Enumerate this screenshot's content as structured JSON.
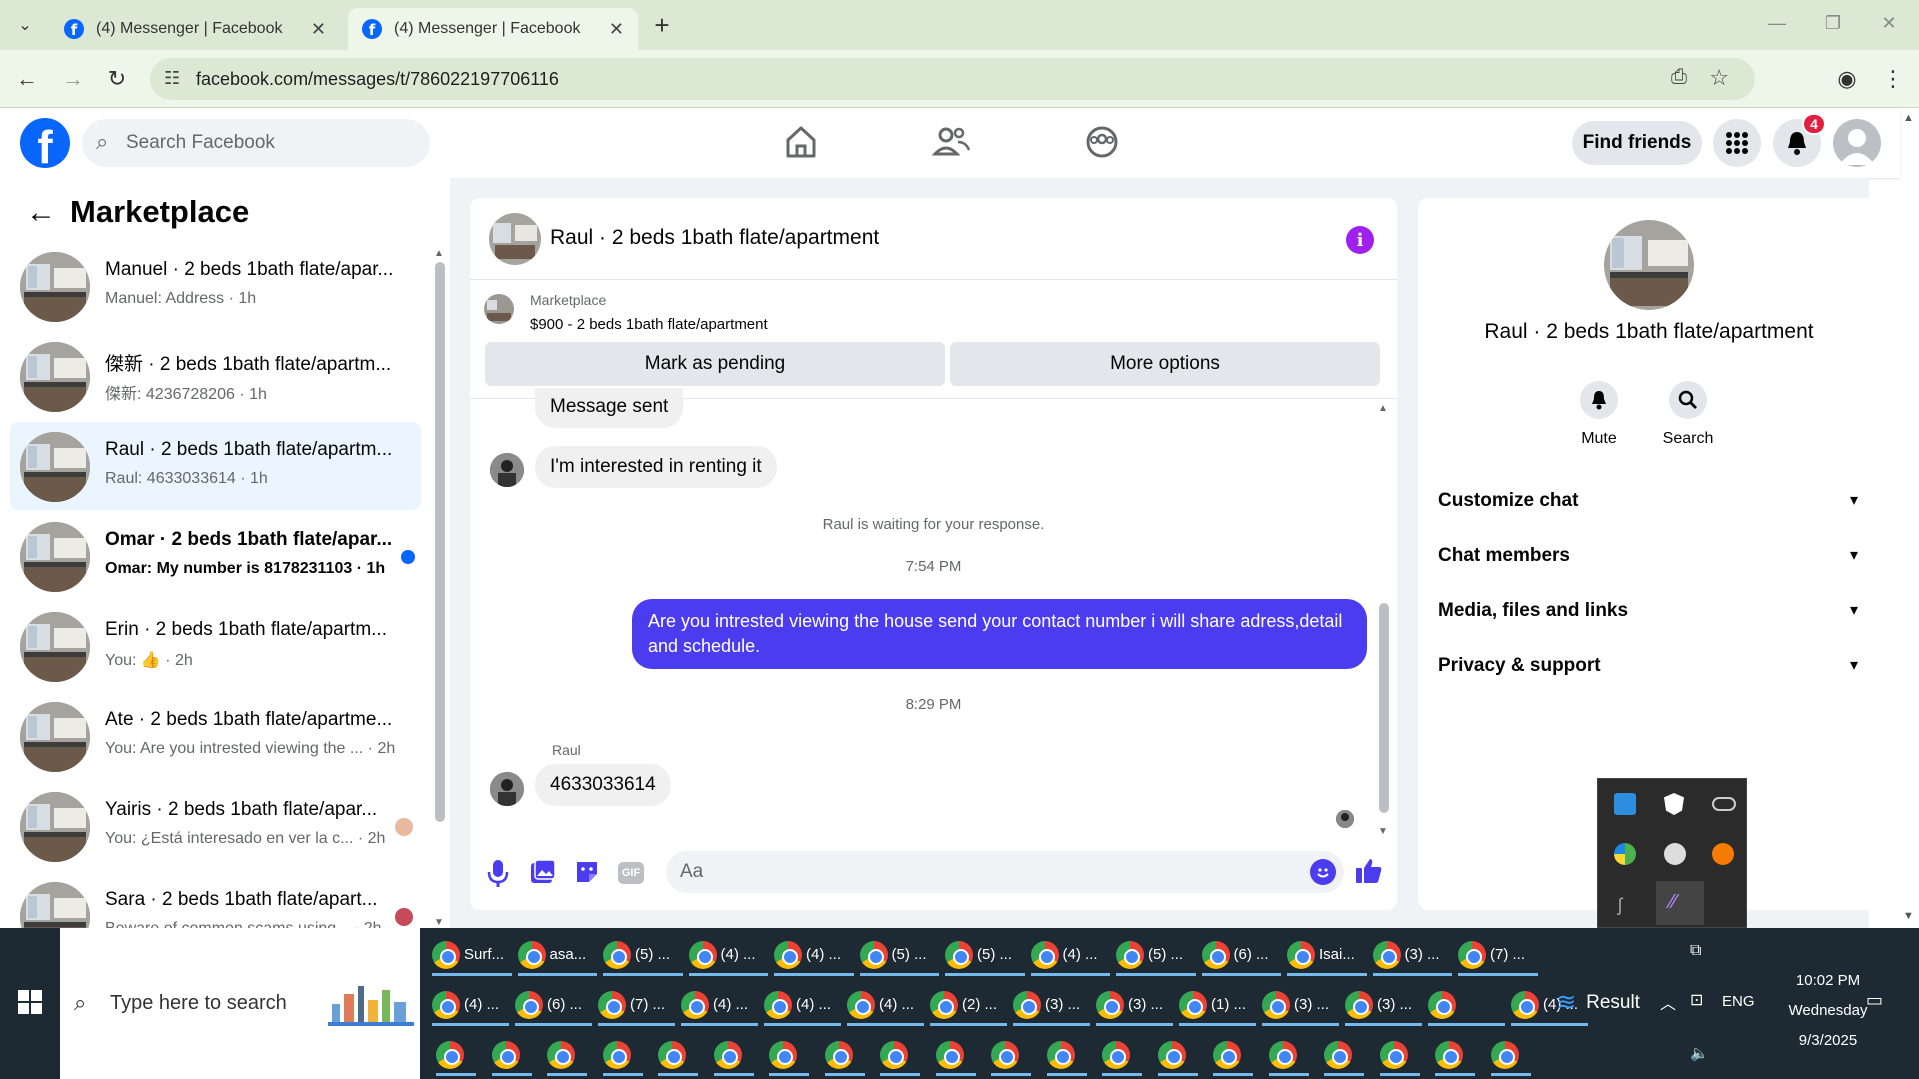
{
  "browser": {
    "tabs": [
      {
        "title": "(4) Messenger | Facebook"
      },
      {
        "title": "(4) Messenger | Facebook"
      }
    ],
    "url": "facebook.com/messages/t/786022197706116"
  },
  "fb": {
    "search_placeholder": "Search Facebook",
    "find_friends": "Find friends",
    "notif_count": "4"
  },
  "sidebar": {
    "title": "Marketplace",
    "conversations": [
      {
        "title": "Manuel · 2 beds 1bath flate/apar...",
        "preview": "Manuel: Address · 1h"
      },
      {
        "title": "傑新 · 2 beds 1bath flate/apartm...",
        "preview": "傑新: 4236728206 · 1h"
      },
      {
        "title": "Raul · 2 beds 1bath flate/apartm...",
        "preview": "Raul: 4633033614 · 1h"
      },
      {
        "title": "Omar · 2 beds 1bath flate/apar...",
        "preview": "Omar: My number is 8178231103 · 1h"
      },
      {
        "title": "Erin · 2 beds 1bath flate/apartm...",
        "preview": "You: 👍 · 2h"
      },
      {
        "title": "Ate · 2 beds 1bath flate/apartme...",
        "preview": "You: Are you intrested viewing the ... · 2h"
      },
      {
        "title": "Yairis · 2 beds 1bath flate/apar...",
        "preview": "You: ¿Está interesado en ver la c... · 2h"
      },
      {
        "title": "Sara · 2 beds 1bath flate/apart...",
        "preview": "Beware of common scams using... · 2h"
      }
    ]
  },
  "chat": {
    "title": "Raul · 2 beds 1bath flate/apartment",
    "listing_source": "Marketplace",
    "listing_detail": "$900 - 2 beds 1bath flate/apartment",
    "mark_pending": "Mark as pending",
    "more_options": "More options",
    "messages": {
      "sent_partial": "Message sent",
      "m1": "I'm interested in renting it",
      "waiting": "Raul is waiting for your response.",
      "time1": "7:54 PM",
      "m2": "Are you intrested viewing the house send your contact number i will share adress,detail and schedule.",
      "time2": "8:29 PM",
      "sender": "Raul",
      "m3": "4633033614"
    },
    "input_placeholder": "Aa"
  },
  "info": {
    "name": "Raul · 2 beds 1bath flate/apartment",
    "mute": "Mute",
    "search": "Search",
    "sections": [
      "Customize chat",
      "Chat members",
      "Media, files and links",
      "Privacy & support"
    ]
  },
  "taskbar": {
    "search_placeholder": "Type here to search",
    "row1": [
      "Surf...",
      "asa...",
      "(5) ...",
      "(4) ...",
      "(4) ...",
      "(5) ...",
      "(5) ...",
      "(4) ...",
      "(5) ...",
      "(6) ...",
      "Isai...",
      "(3) ...",
      "(7) ..."
    ],
    "row2": [
      "(4) ...",
      "(6) ...",
      "(7) ...",
      "(4) ...",
      "(4) ...",
      "(4) ...",
      "(2) ...",
      "(3) ...",
      "(3) ...",
      "(1) ...",
      "(3) ...",
      "(3) ...",
      "",
      "(4) ..."
    ],
    "result": "Result",
    "lang": "ENG",
    "time": "10:02 PM",
    "day": "Wednesday",
    "date": "9/3/2025"
  }
}
